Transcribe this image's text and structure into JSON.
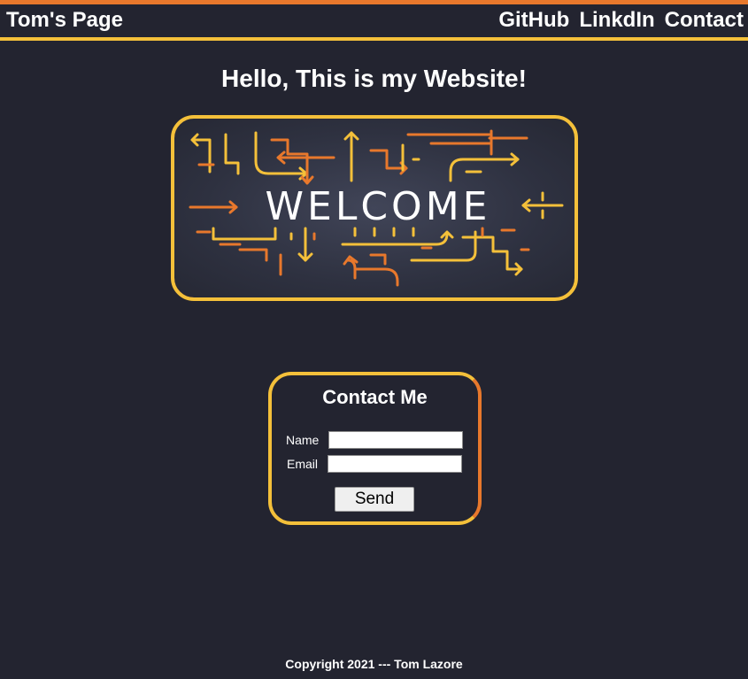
{
  "header": {
    "brand": "Tom's Page",
    "nav": [
      "GitHub",
      "LinkdIn",
      "Contact"
    ]
  },
  "main": {
    "headline": "Hello, This is my Website!",
    "welcome_image_text": "WELCOME"
  },
  "contact": {
    "title": "Contact Me",
    "name_label": "Name",
    "name_value": "",
    "email_label": "Email",
    "email_value": "",
    "send_label": "Send"
  },
  "footer": {
    "copyright": "Copyright 2021 --- Tom Lazore"
  },
  "colors": {
    "background": "#232430",
    "accent_orange": "#e8782c",
    "accent_yellow": "#f4c03a"
  }
}
